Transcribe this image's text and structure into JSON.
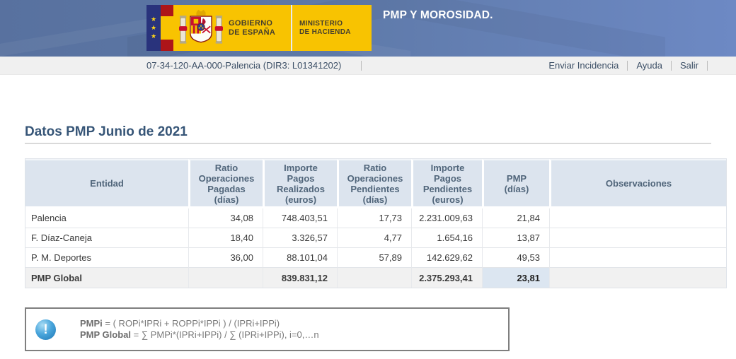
{
  "header": {
    "title": "PMP Y MOROSIDAD.",
    "logo": {
      "gobierno": "GOBIERNO\nDE ESPAÑA",
      "ministerio": "MINISTERIO\nDE HACIENDA"
    }
  },
  "menubar": {
    "breadcrumb": "07-34-120-AA-000-Palencia (DIR3: L01341202)",
    "links": [
      "Enviar Incidencia",
      "Ayuda",
      "Salir"
    ]
  },
  "main": {
    "page_title": "Datos PMP Junio de 2021",
    "table": {
      "columns": [
        "Entidad",
        "Ratio\nOperaciones\nPagadas\n(días)",
        "Importe\nPagos\nRealizados\n(euros)",
        "Ratio\nOperaciones\nPendientes\n(días)",
        "Importe\nPagos\nPendientes\n(euros)",
        "PMP\n(días)",
        "Observaciones"
      ],
      "rows": [
        [
          "Palencia",
          "34,08",
          "748.403,51",
          "17,73",
          "2.231.009,63",
          "21,84",
          ""
        ],
        [
          "F. Díaz-Caneja",
          "18,40",
          "3.326,57",
          "4,77",
          "1.654,16",
          "13,87",
          ""
        ],
        [
          "P. M. Deportes",
          "36,00",
          "88.101,04",
          "57,89",
          "142.629,62",
          "49,53",
          ""
        ]
      ],
      "total_row": [
        "PMP Global",
        "",
        "839.831,12",
        "",
        "2.375.293,41",
        "23,81",
        ""
      ]
    },
    "info_box": {
      "icon": "info-exclamation-icon",
      "lines": [
        {
          "bold": "PMPi",
          "rest": " = ( ROPi*IPRi + ROPPi*IPPi ) / (IPRi+IPPi)"
        },
        {
          "bold": "PMP Global",
          "rest": " = ∑ PMPi*(IPRi+IPPi) / ∑ (IPRi+IPPi), i=0,…n"
        }
      ]
    }
  },
  "colors": {
    "banner_blue_left": "#58719f",
    "banner_blue_right": "#6d89c4",
    "logo_yellow": "#f8c301",
    "logo_red": "#ad1519",
    "eu_blue": "#29337c",
    "menubar_bg": "#f0f0f0",
    "link_navy": "#3c4f66",
    "title_navy": "#365577",
    "table_header_bg": "#dce4ee",
    "table_header_text": "#50657a",
    "total_row_bg": "#f1f1f1",
    "pmp_highlight_bg": "#dce6f1",
    "info_icon_blue": "#4aa6dc",
    "info_border_gray": "#7f7f7f"
  }
}
